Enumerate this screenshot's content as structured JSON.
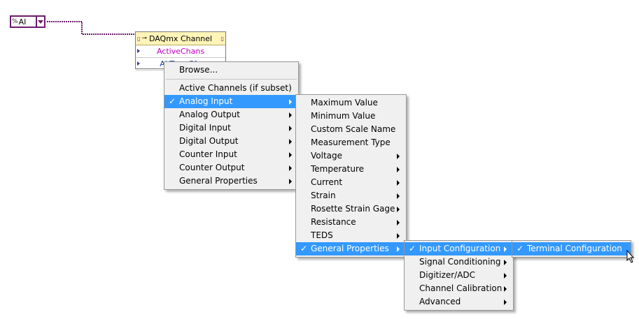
{
  "constant": {
    "icon": "%",
    "label": "AI"
  },
  "property_node": {
    "title": "DAQmx Channel",
    "properties": [
      "ActiveChans",
      "AI.TermCfg"
    ]
  },
  "menu1": {
    "browse": "Browse...",
    "items": [
      {
        "label": "Active Channels (if subset)",
        "checked": false,
        "submenu": false,
        "highlighted": false
      },
      {
        "label": "Analog Input",
        "checked": true,
        "submenu": true,
        "highlighted": true
      },
      {
        "label": "Analog Output",
        "checked": false,
        "submenu": true,
        "highlighted": false
      },
      {
        "label": "Digital Input",
        "checked": false,
        "submenu": true,
        "highlighted": false
      },
      {
        "label": "Digital Output",
        "checked": false,
        "submenu": true,
        "highlighted": false
      },
      {
        "label": "Counter Input",
        "checked": false,
        "submenu": true,
        "highlighted": false
      },
      {
        "label": "Counter Output",
        "checked": false,
        "submenu": true,
        "highlighted": false
      },
      {
        "label": "General Properties",
        "checked": false,
        "submenu": true,
        "highlighted": false
      }
    ]
  },
  "menu2": {
    "items": [
      {
        "label": "Maximum Value"
      },
      {
        "label": "Minimum Value"
      },
      {
        "label": "Custom Scale Name"
      },
      {
        "label": "Measurement Type"
      },
      {
        "label": "Voltage"
      },
      {
        "label": "Temperature"
      },
      {
        "label": "Current"
      },
      {
        "label": "Strain"
      },
      {
        "label": "Rosette Strain Gage"
      },
      {
        "label": "Resistance"
      },
      {
        "label": "TEDS"
      },
      {
        "label": "General Properties"
      }
    ]
  },
  "menu3": {
    "items": [
      {
        "label": "Input Configuration"
      },
      {
        "label": "Signal Conditioning"
      },
      {
        "label": "Digitizer/ADC"
      },
      {
        "label": "Channel Calibration"
      },
      {
        "label": "Advanced"
      }
    ]
  },
  "menu4": {
    "items": [
      {
        "label": "Terminal Configuration"
      }
    ]
  },
  "check_glyph": "✓",
  "colors": {
    "highlight": "#3399ff",
    "wire": "#6d1c6d",
    "menu_bg": "#f0f0f0",
    "node_header": "#fff4b8"
  }
}
